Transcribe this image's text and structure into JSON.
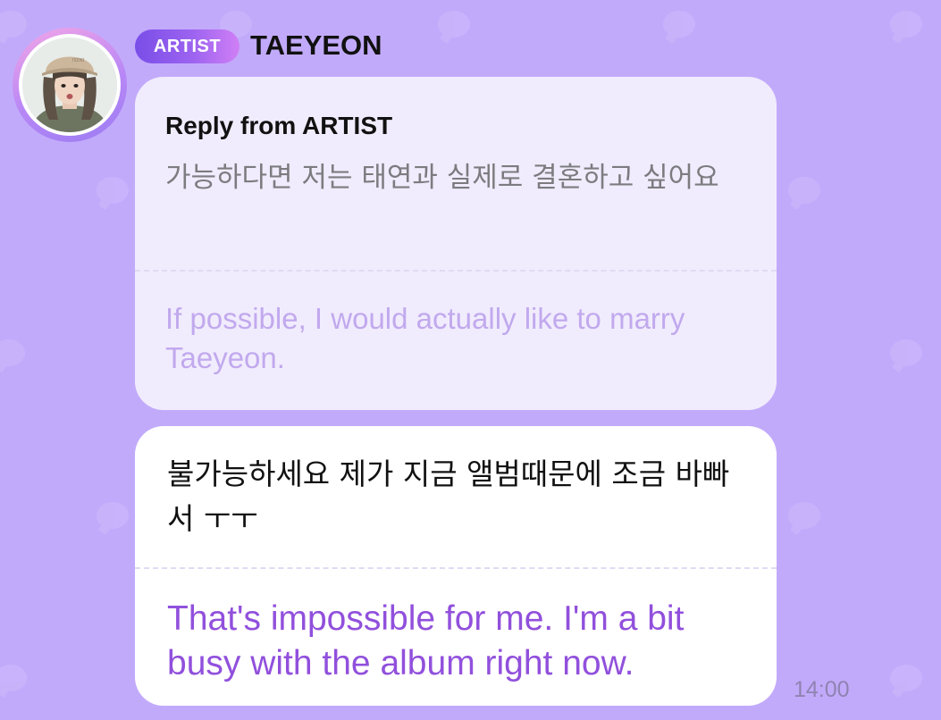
{
  "sender": {
    "badge_label": "ARTIST",
    "name": "TAEYEON",
    "avatar_icon": "profile-photo"
  },
  "quoted_message": {
    "header": "Reply from ARTIST",
    "original": "가능하다면 저는 태연과 실제로 결혼하고 싶어요",
    "translation": "If possible, I would actually like to marry Taeyeon."
  },
  "reply_message": {
    "original": "불가능하세요 제가 지금 앨범때문에 조금 바빠서 ㅜㅜ",
    "translation": "That's impossible for me. I'm a bit busy with the album right now."
  },
  "timestamp": "14:00",
  "colors": {
    "background": "#c2aafb",
    "badge_start": "#7a4ee8",
    "badge_end": "#d07ff5",
    "quoted_bubble": "#f1ecfd",
    "reply_bubble": "#ffffff",
    "translation_accent": "#9150dc"
  }
}
